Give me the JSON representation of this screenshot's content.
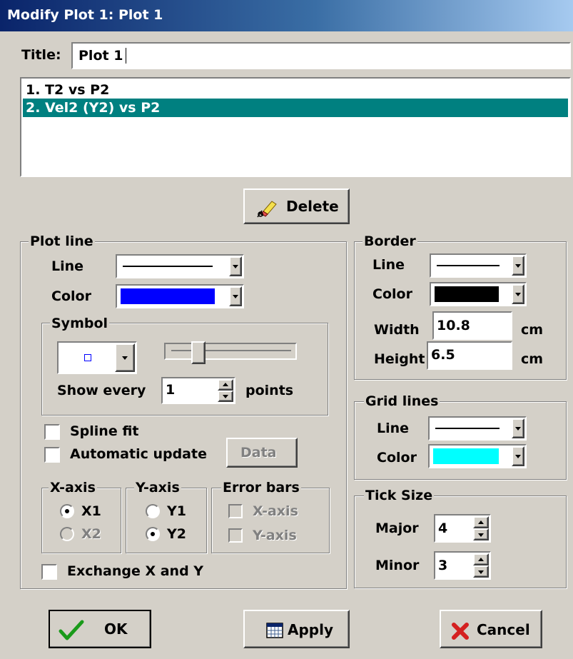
{
  "window": {
    "title": "Modify Plot 1: Plot 1"
  },
  "title_field": {
    "label": "Title:",
    "value": "Plot 1"
  },
  "plot_list": {
    "items": [
      {
        "label": "1.  T2 vs P2",
        "selected": false
      },
      {
        "label": "2.  Vel2 (Y2) vs P2",
        "selected": true
      }
    ],
    "selection_color": "#008080"
  },
  "delete_button": {
    "label": "Delete"
  },
  "plot_line": {
    "legend": "Plot line",
    "line_label": "Line",
    "color_label": "Color",
    "color_value": "#0000ff",
    "symbol": {
      "legend": "Symbol",
      "show_every_label": "Show every",
      "show_every_value": "1",
      "points_label": "points"
    },
    "spline_fit_label": "Spline fit",
    "automatic_update_label": "Automatic update",
    "data_button_label": "Data",
    "x_axis": {
      "legend": "X-axis",
      "options": [
        "X1",
        "X2"
      ],
      "selected": "X1"
    },
    "y_axis": {
      "legend": "Y-axis",
      "options": [
        "Y1",
        "Y2"
      ],
      "selected": "Y2"
    },
    "error_bars": {
      "legend": "Error bars",
      "x_label": "X-axis",
      "y_label": "Y-axis"
    },
    "exchange_label": "Exchange X and Y"
  },
  "border": {
    "legend": "Border",
    "line_label": "Line",
    "color_label": "Color",
    "color_value": "#000000",
    "width_label": "Width",
    "width_value": "10.8",
    "height_label": "Height",
    "height_value": "6.5",
    "unit": "cm"
  },
  "grid_lines": {
    "legend": "Grid lines",
    "line_label": "Line",
    "color_label": "Color",
    "color_value": "#00ffff"
  },
  "tick_size": {
    "legend": "Tick Size",
    "major_label": "Major",
    "major_value": "4",
    "minor_label": "Minor",
    "minor_value": "3"
  },
  "buttons": {
    "ok": "OK",
    "apply": "Apply",
    "cancel": "Cancel"
  },
  "icons": {
    "ok": "checkmark-icon",
    "apply": "calendar-icon",
    "cancel": "red-x-icon",
    "delete": "eraser-icon"
  }
}
